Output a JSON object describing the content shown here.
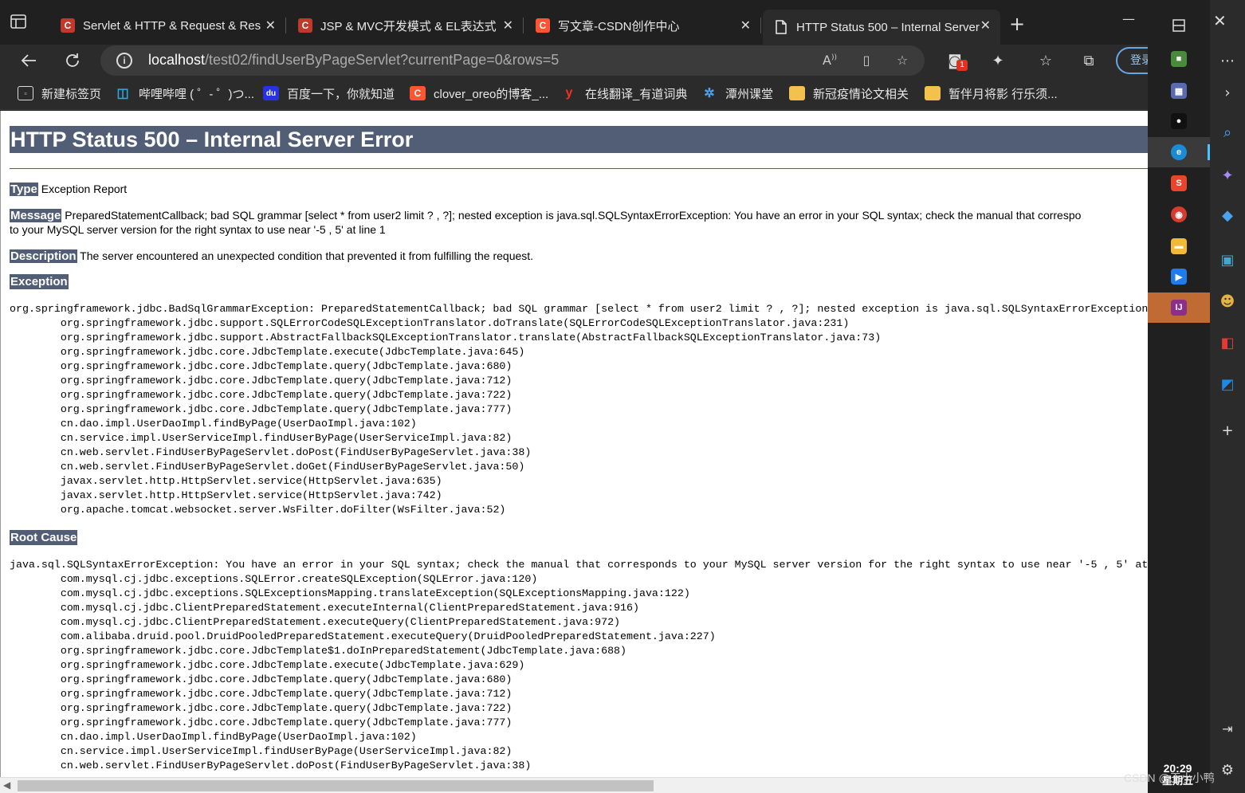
{
  "tabs": [
    {
      "title": "Servlet & HTTP & Request & Res",
      "favicon": "C",
      "color": "#c0392b"
    },
    {
      "title": "JSP & MVC开发模式 & EL表达式",
      "favicon": "C",
      "color": "#c0392b"
    },
    {
      "title": "写文章-CSDN创作中心",
      "favicon": "C",
      "color": "#fc5531"
    },
    {
      "title": "HTTP Status 500 – Internal Server",
      "favicon": "page-icon",
      "color": "#ffffff"
    }
  ],
  "toolbar": {
    "url_host": "localhost",
    "url_path": "/test02/findUserByPageServlet?currentPage=0&rows=5",
    "login_label": "登录",
    "extension_badge": "1"
  },
  "bookmarks": [
    {
      "label": "新建标签页",
      "icon": "new-tab-icon"
    },
    {
      "label": "哔哩哔哩 ( ゜- ゜)つ...",
      "icon": "bilibili-icon"
    },
    {
      "label": "百度一下，你就知道",
      "icon": "baidu-icon"
    },
    {
      "label": "clover_oreo的博客_...",
      "icon": "csdn-icon"
    },
    {
      "label": "在线翻译_有道词典",
      "icon": "youdao-icon"
    },
    {
      "label": "潭州课堂",
      "icon": "tanzhou-icon"
    },
    {
      "label": "新冠疫情论文相关",
      "icon": "folder-icon"
    },
    {
      "label": "暂伴月将影 行乐须...",
      "icon": "folder-icon"
    }
  ],
  "page": {
    "title": "HTTP Status 500 – Internal Server Error",
    "type_label": "Type",
    "type_value": "Exception Report",
    "message_label": "Message",
    "message_line1": "PreparedStatementCallback; bad SQL grammar [select * from user2 limit ? , ?]; nested exception is java.sql.SQLSyntaxErrorException: You have an error in your SQL syntax; check the manual that correspo",
    "message_line2": "to your MySQL server version for the right syntax to use near '-5 , 5' at line 1",
    "description_label": "Description",
    "description_value": "The server encountered an unexpected condition that prevented it from fulfilling the request.",
    "exception_label": "Exception",
    "exception_trace": "org.springframework.jdbc.BadSqlGrammarException: PreparedStatementCallback; bad SQL grammar [select * from user2 limit ? , ?]; nested exception is java.sql.SQLSyntaxErrorException\n\torg.springframework.jdbc.support.SQLErrorCodeSQLExceptionTranslator.doTranslate(SQLErrorCodeSQLExceptionTranslator.java:231)\n\torg.springframework.jdbc.support.AbstractFallbackSQLExceptionTranslator.translate(AbstractFallbackSQLExceptionTranslator.java:73)\n\torg.springframework.jdbc.core.JdbcTemplate.execute(JdbcTemplate.java:645)\n\torg.springframework.jdbc.core.JdbcTemplate.query(JdbcTemplate.java:680)\n\torg.springframework.jdbc.core.JdbcTemplate.query(JdbcTemplate.java:712)\n\torg.springframework.jdbc.core.JdbcTemplate.query(JdbcTemplate.java:722)\n\torg.springframework.jdbc.core.JdbcTemplate.query(JdbcTemplate.java:777)\n\tcn.dao.impl.UserDaoImpl.findByPage(UserDaoImpl.java:102)\n\tcn.service.impl.UserServiceImpl.findUserByPage(UserServiceImpl.java:82)\n\tcn.web.servlet.FindUserByPageServlet.doPost(FindUserByPageServlet.java:38)\n\tcn.web.servlet.FindUserByPageServlet.doGet(FindUserByPageServlet.java:50)\n\tjavax.servlet.http.HttpServlet.service(HttpServlet.java:635)\n\tjavax.servlet.http.HttpServlet.service(HttpServlet.java:742)\n\torg.apache.tomcat.websocket.server.WsFilter.doFilter(WsFilter.java:52)",
    "root_cause_label": "Root Cause",
    "root_cause_trace": "java.sql.SQLSyntaxErrorException: You have an error in your SQL syntax; check the manual that corresponds to your MySQL server version for the right syntax to use near '-5 , 5' at\n\tcom.mysql.cj.jdbc.exceptions.SQLError.createSQLException(SQLError.java:120)\n\tcom.mysql.cj.jdbc.exceptions.SQLExceptionsMapping.translateException(SQLExceptionsMapping.java:122)\n\tcom.mysql.cj.jdbc.ClientPreparedStatement.executeInternal(ClientPreparedStatement.java:916)\n\tcom.mysql.cj.jdbc.ClientPreparedStatement.executeQuery(ClientPreparedStatement.java:972)\n\tcom.alibaba.druid.pool.DruidPooledPreparedStatement.executeQuery(DruidPooledPreparedStatement.java:227)\n\torg.springframework.jdbc.core.JdbcTemplate$1.doInPreparedStatement(JdbcTemplate.java:688)\n\torg.springframework.jdbc.core.JdbcTemplate.execute(JdbcTemplate.java:629)\n\torg.springframework.jdbc.core.JdbcTemplate.query(JdbcTemplate.java:680)\n\torg.springframework.jdbc.core.JdbcTemplate.query(JdbcTemplate.java:712)\n\torg.springframework.jdbc.core.JdbcTemplate.query(JdbcTemplate.java:722)\n\torg.springframework.jdbc.core.JdbcTemplate.query(JdbcTemplate.java:777)\n\tcn.dao.impl.UserDaoImpl.findByPage(UserDaoImpl.java:102)\n\tcn.service.impl.UserServiceImpl.findUserByPage(UserServiceImpl.java:82)\n\tcn.web.servlet.FindUserByPageServlet.doPost(FindUserByPageServlet.java:38)"
  },
  "taskbar": {
    "apps": [
      {
        "name": "app-icon-1",
        "color": "#4a8a3c",
        "glyph": "■"
      },
      {
        "name": "calculator-icon",
        "color": "#5a6ab0",
        "glyph": "▦"
      },
      {
        "name": "qq-icon",
        "color": "#111111",
        "glyph": "●"
      },
      {
        "name": "edge-icon",
        "color": "#1b8bd6",
        "glyph": "e"
      },
      {
        "name": "sogou-icon",
        "color": "#e8452c",
        "glyph": "S"
      },
      {
        "name": "chrome-icon",
        "color": "#d63b30",
        "glyph": "◉"
      },
      {
        "name": "file-explorer-icon",
        "color": "#f2b935",
        "glyph": "▬"
      },
      {
        "name": "feishu-icon",
        "color": "#1f7ce8",
        "glyph": "▶"
      },
      {
        "name": "intellij-icon",
        "color": "#8b2f8a",
        "glyph": "IJ"
      }
    ],
    "time": "20:29",
    "day": "星期五"
  },
  "watermark": "CSDN @王小小鸭"
}
